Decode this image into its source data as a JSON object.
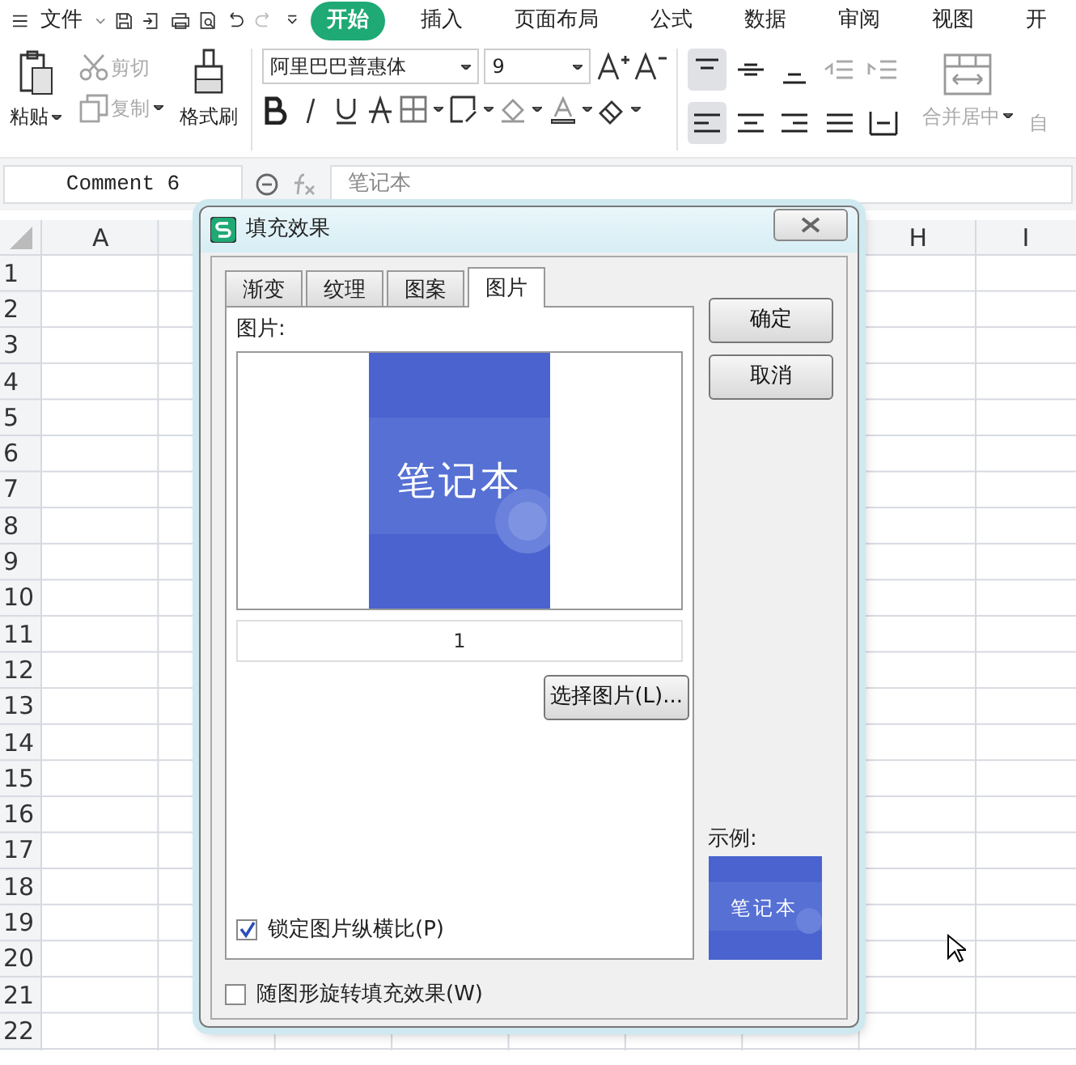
{
  "menu_bar": {
    "file_label": "文件",
    "tabs": [
      {
        "label": "开始",
        "selected": true
      },
      {
        "label": "插入",
        "selected": false
      },
      {
        "label": "页面布局",
        "selected": false
      },
      {
        "label": "公式",
        "selected": false
      },
      {
        "label": "数据",
        "selected": false
      },
      {
        "label": "审阅",
        "selected": false
      },
      {
        "label": "视图",
        "selected": false
      },
      {
        "label": "开",
        "selected": false
      }
    ]
  },
  "ribbon": {
    "paste": {
      "label": "粘贴"
    },
    "cut": {
      "label": "剪切",
      "disabled": true
    },
    "copy": {
      "label": "复制",
      "disabled": true
    },
    "format_painter": {
      "label": "格式刷"
    },
    "font_name": "阿里巴巴普惠体",
    "font_size": "9",
    "alignment": [
      {
        "kind": "top",
        "selected": true,
        "disabled": false
      },
      {
        "kind": "middle",
        "selected": false,
        "disabled": false
      },
      {
        "kind": "bottom",
        "selected": false,
        "disabled": false
      },
      {
        "kind": "outdent",
        "selected": false,
        "disabled": true
      },
      {
        "kind": "indent",
        "selected": false,
        "disabled": true
      },
      {
        "kind": "left",
        "selected": true,
        "disabled": false
      },
      {
        "kind": "center",
        "selected": false,
        "disabled": false
      },
      {
        "kind": "right",
        "selected": false,
        "disabled": false
      },
      {
        "kind": "justify",
        "selected": false,
        "disabled": false
      },
      {
        "kind": "distributed",
        "selected": false,
        "disabled": false
      }
    ],
    "merge": {
      "label": "合并居中",
      "disabled": true
    },
    "wrap": {
      "label": "自",
      "disabled": true
    }
  },
  "formula_bar": {
    "name_box": "Comment 6",
    "content": "笔记本"
  },
  "sheet": {
    "columns_left": [
      "A"
    ],
    "columns_right": [
      "H",
      "I"
    ],
    "rows": [
      "1",
      "2",
      "3",
      "4",
      "5",
      "6",
      "7",
      "8",
      "9",
      "10",
      "11",
      "12",
      "13",
      "14",
      "15",
      "16",
      "17",
      "18",
      "19",
      "20",
      "21",
      "22"
    ]
  },
  "dialog": {
    "title": "填充效果",
    "tabs": [
      {
        "label": "渐变",
        "selected": false
      },
      {
        "label": "纹理",
        "selected": false
      },
      {
        "label": "图案",
        "selected": false
      },
      {
        "label": "图片",
        "selected": true
      }
    ],
    "picture_label": "图片:",
    "picture_text": "笔记本",
    "page_number": "1",
    "select_button": "选择图片(L)...",
    "lock_ratio": {
      "label": "锁定图片纵横比(P)",
      "checked": true
    },
    "ok_button": "确定",
    "cancel_button": "取消",
    "sample_label": "示例:",
    "sample_text": "笔记本",
    "rotate_with_shape": {
      "label": "随图形旋转填充效果(W)",
      "checked": false
    }
  }
}
